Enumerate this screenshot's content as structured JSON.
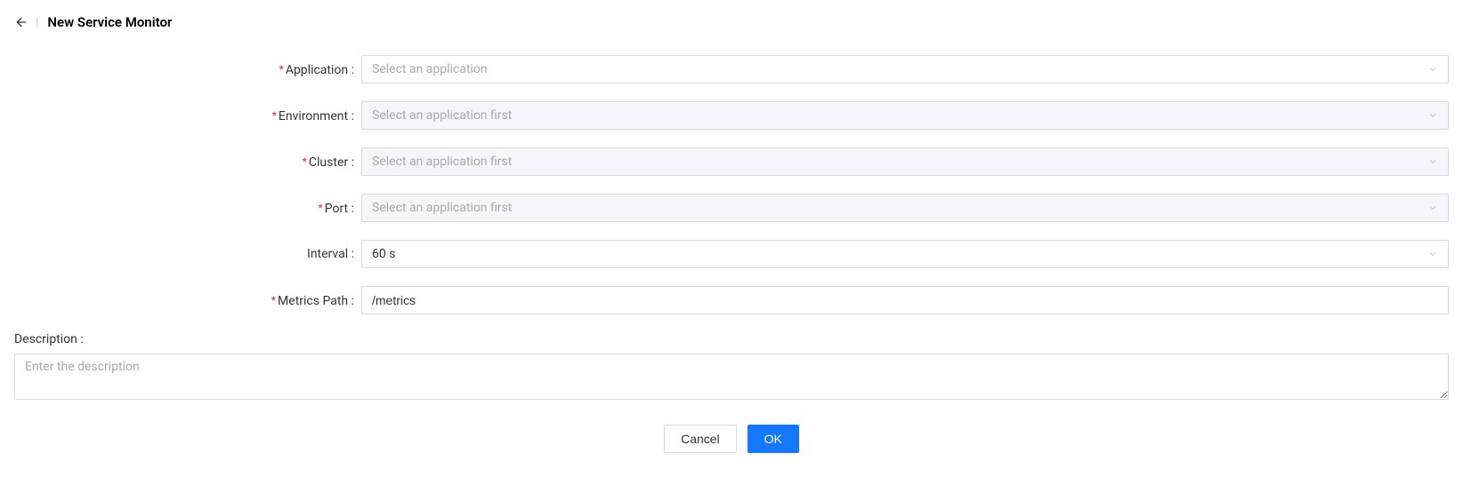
{
  "header": {
    "title": "New Service Monitor"
  },
  "fields": {
    "application": {
      "label": "Application",
      "placeholder": "Select an application"
    },
    "environment": {
      "label": "Environment",
      "placeholder": "Select an application first"
    },
    "cluster": {
      "label": "Cluster",
      "placeholder": "Select an application first"
    },
    "port": {
      "label": "Port",
      "placeholder": "Select an application first"
    },
    "interval": {
      "label": "Interval",
      "value": "60 s"
    },
    "metrics_path": {
      "label": "Metrics Path",
      "value": "/metrics"
    },
    "description": {
      "label": "Description",
      "placeholder": "Enter the description"
    }
  },
  "buttons": {
    "cancel": "Cancel",
    "ok": "OK"
  },
  "colon": ":",
  "colon_spaced": " :"
}
